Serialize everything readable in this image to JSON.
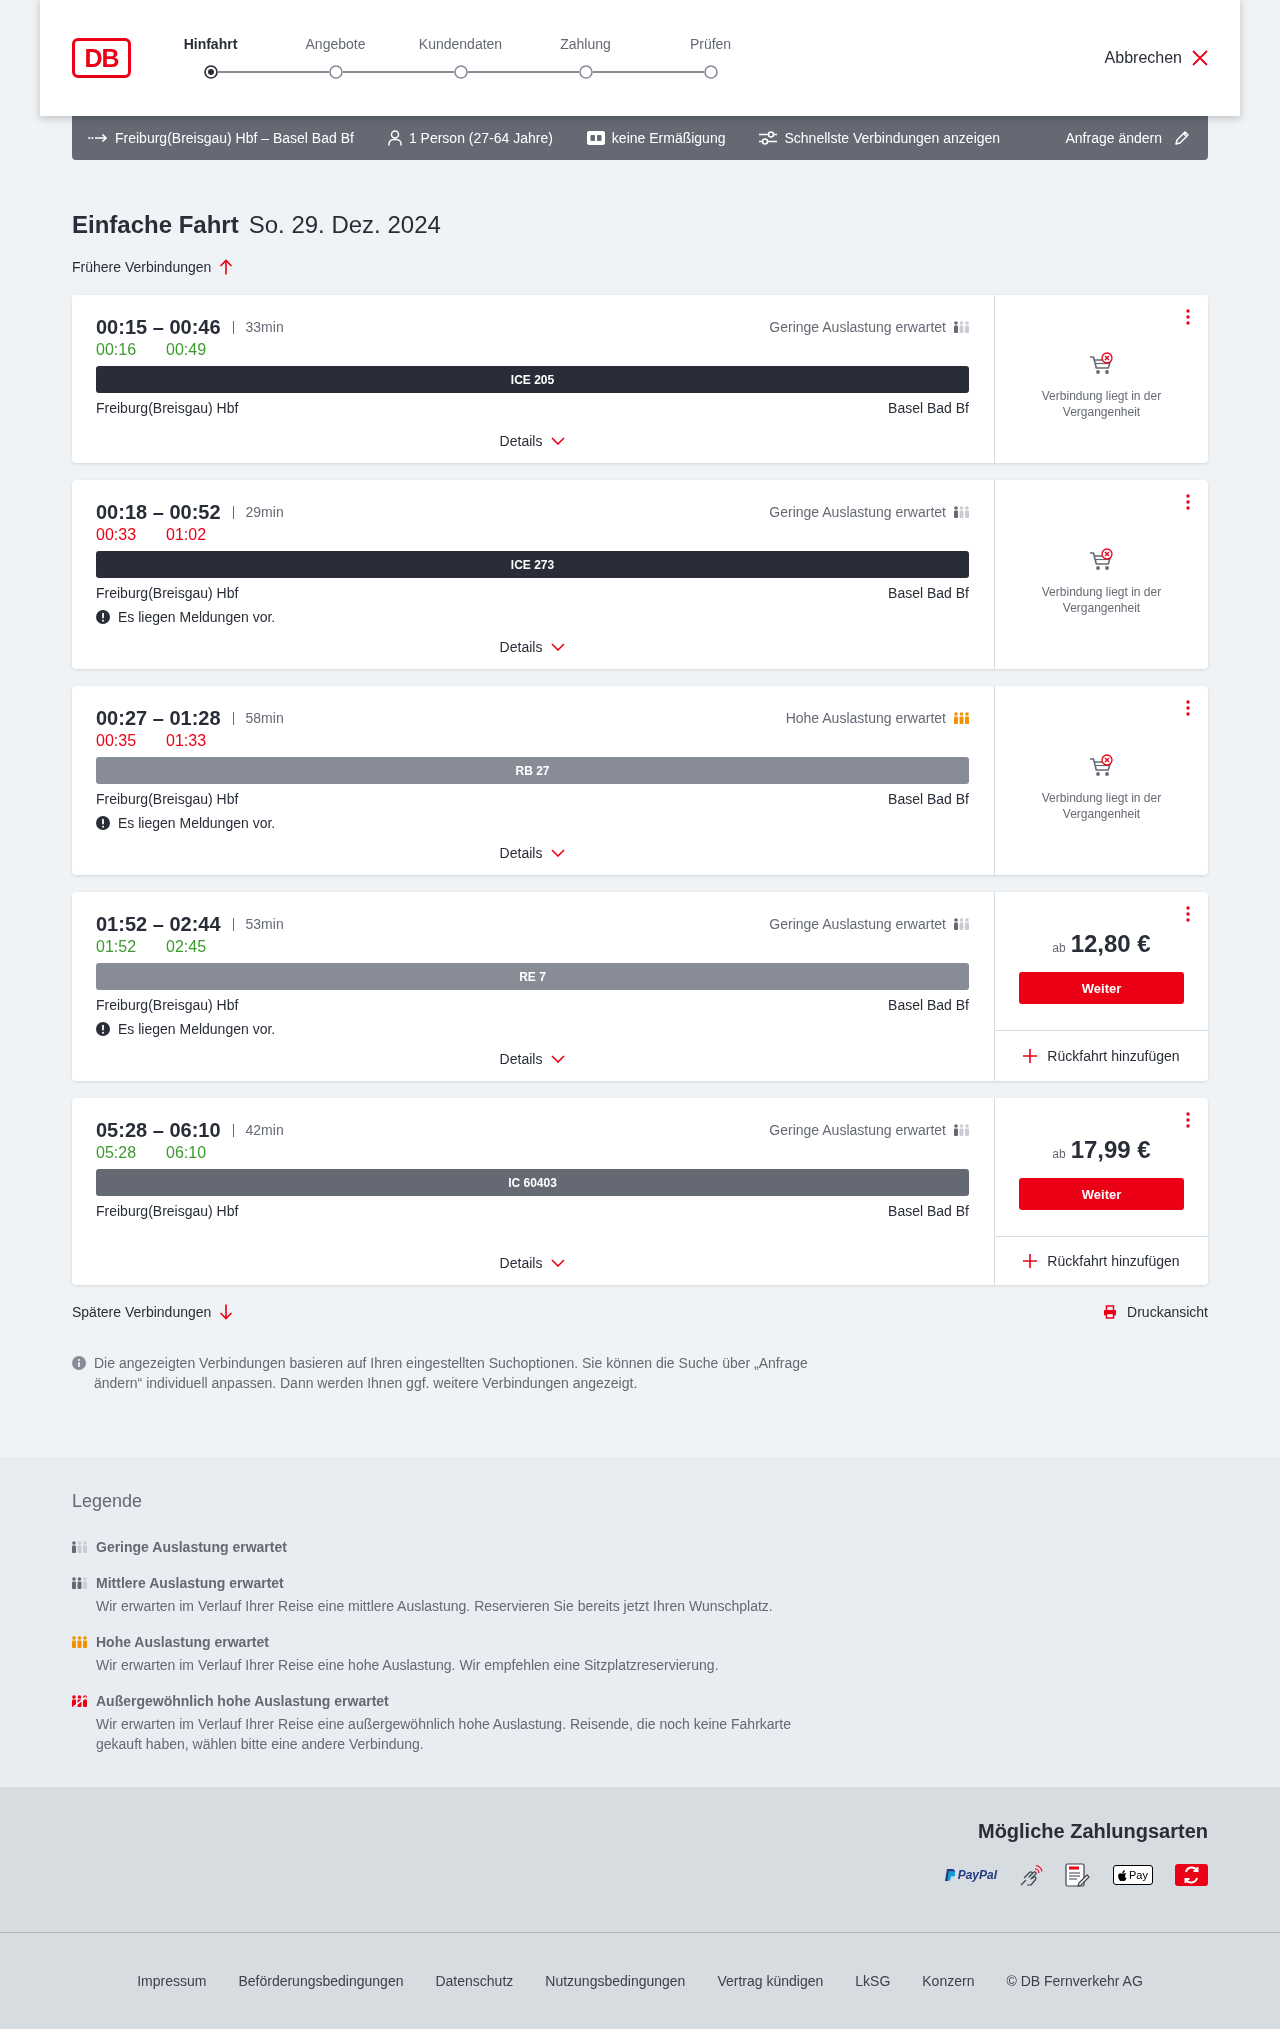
{
  "header": {
    "logo": "DB",
    "steps": [
      {
        "label": "Hinfahrt",
        "selected": true
      },
      {
        "label": "Angebote",
        "selected": false
      },
      {
        "label": "Kundendaten",
        "selected": false
      },
      {
        "label": "Zahlung",
        "selected": false
      },
      {
        "label": "Prüfen",
        "selected": false
      }
    ],
    "cancel": "Abbrechen"
  },
  "search_summary": {
    "items": [
      {
        "kind": "route",
        "label": "Freiburg(Breisgau) Hbf – Basel Bad Bf"
      },
      {
        "kind": "passengers",
        "label": "1 Person (27-64 Jahre)"
      },
      {
        "kind": "discount",
        "label": "keine Ermäßigung"
      },
      {
        "kind": "filter",
        "label": "Schnellste Verbindungen anzeigen"
      }
    ],
    "edit": "Anfrage ändern"
  },
  "heading": {
    "title": "Einfache Fahrt",
    "date": "So. 29. Dez. 2024"
  },
  "earlier": "Frühere Verbindungen",
  "connections": [
    {
      "times": "00:15 – 00:46",
      "duration": "33min",
      "realtime": {
        "departure": "00:16",
        "arrival": "00:49",
        "delayed": false
      },
      "occupancy": {
        "kind": "low",
        "label": "Geringe Auslastung erwartet"
      },
      "train": {
        "label": "ICE 205",
        "color": "#282d37"
      },
      "from": "Freiburg(Breisgau) Hbf",
      "to": "Basel Bad Bf",
      "details": "Details",
      "offer": {
        "kind": "past",
        "message": "Verbindung liegt in der Vergangenheit"
      }
    },
    {
      "times": "00:18 – 00:52",
      "duration": "29min",
      "realtime": {
        "departure": "00:33",
        "arrival": "01:02",
        "delayed": true
      },
      "occupancy": {
        "kind": "low",
        "label": "Geringe Auslastung erwartet"
      },
      "train": {
        "label": "ICE 273",
        "color": "#282d37"
      },
      "from": "Freiburg(Breisgau) Hbf",
      "to": "Basel Bad Bf",
      "notice": "Es liegen Meldungen vor.",
      "details": "Details",
      "offer": {
        "kind": "past",
        "message": "Verbindung liegt in der Vergangenheit"
      }
    },
    {
      "times": "00:27 – 01:28",
      "duration": "58min",
      "realtime": {
        "departure": "00:35",
        "arrival": "01:33",
        "delayed": true
      },
      "occupancy": {
        "kind": "high",
        "label": "Hohe Auslastung erwartet"
      },
      "train": {
        "label": "RB 27",
        "color": "#878c96"
      },
      "from": "Freiburg(Breisgau) Hbf",
      "to": "Basel Bad Bf",
      "notice": "Es liegen Meldungen vor.",
      "details": "Details",
      "offer": {
        "kind": "past",
        "message": "Verbindung liegt in der Vergangenheit"
      }
    },
    {
      "times": "01:52 – 02:44",
      "duration": "53min",
      "realtime": {
        "departure": "01:52",
        "arrival": "02:45",
        "delayed": false
      },
      "occupancy": {
        "kind": "low",
        "label": "Geringe Auslastung erwartet"
      },
      "train": {
        "label": "RE 7",
        "color": "#878c96"
      },
      "from": "Freiburg(Breisgau) Hbf",
      "to": "Basel Bad Bf",
      "notice": "Es liegen Meldungen vor.",
      "details": "Details",
      "offer": {
        "kind": "price",
        "prefix": "ab",
        "price": "12,80 €",
        "button": "Weiter",
        "return_trip": "Rückfahrt hinzufügen"
      }
    },
    {
      "times": "05:28 – 06:10",
      "duration": "42min",
      "realtime": {
        "departure": "05:28",
        "arrival": "06:10",
        "delayed": false
      },
      "occupancy": {
        "kind": "low",
        "label": "Geringe Auslastung erwartet"
      },
      "train": {
        "label": "IC 60403",
        "color": "#646973"
      },
      "from": "Freiburg(Breisgau) Hbf",
      "to": "Basel Bad Bf",
      "details": "Details",
      "offer": {
        "kind": "price",
        "prefix": "ab",
        "price": "17,99 €",
        "button": "Weiter",
        "return_trip": "Rückfahrt hinzufügen"
      }
    }
  ],
  "later": "Spätere Verbindungen",
  "print": "Druckansicht",
  "info": "Die angezeigten Verbindungen basieren auf Ihren eingestellten Suchoptionen. Sie können die Suche über „Anfrage ändern“ individuell anpassen. Dann werden Ihnen ggf. weitere Verbindungen angezeigt.",
  "legend": {
    "title": "Legende",
    "items": [
      {
        "kind": "low",
        "title": "Geringe Auslastung erwartet"
      },
      {
        "kind": "medium",
        "title": "Mittlere Auslastung erwartet",
        "description": "Wir erwarten im Verlauf Ihrer Reise eine mittlere Auslastung. Reservieren Sie bereits jetzt Ihren Wunschplatz."
      },
      {
        "kind": "high",
        "title": "Hohe Auslastung erwartet",
        "description": "Wir erwarten im Verlauf Ihrer Reise eine hohe Auslastung. Wir empfehlen eine Sitzplatzreservierung."
      },
      {
        "kind": "exceptional",
        "title": "Außergewöhnlich hohe Auslastung erwartet",
        "description": "Wir erwarten im Verlauf Ihrer Reise eine außergewöhnlich hohe Auslastung. Reisende, die noch keine Fahrkarte gekauft haben, wählen bitte eine andere Verbindung."
      }
    ]
  },
  "payment": {
    "title": "Mögliche Zahlungsarten",
    "methods": [
      {
        "kind": "paypal",
        "label": "PayPal"
      },
      {
        "kind": "contactless"
      },
      {
        "kind": "sepa"
      },
      {
        "kind": "applepay",
        "label": "Pay"
      },
      {
        "kind": "bonus"
      }
    ]
  },
  "footer": {
    "links": [
      "Impressum",
      "Beförderungsbedingungen",
      "Datenschutz",
      "Nutzungsbedingungen",
      "Vertrag kündigen",
      "LkSG",
      "Konzern"
    ],
    "copyright": "© DB Fernverkehr AG"
  }
}
